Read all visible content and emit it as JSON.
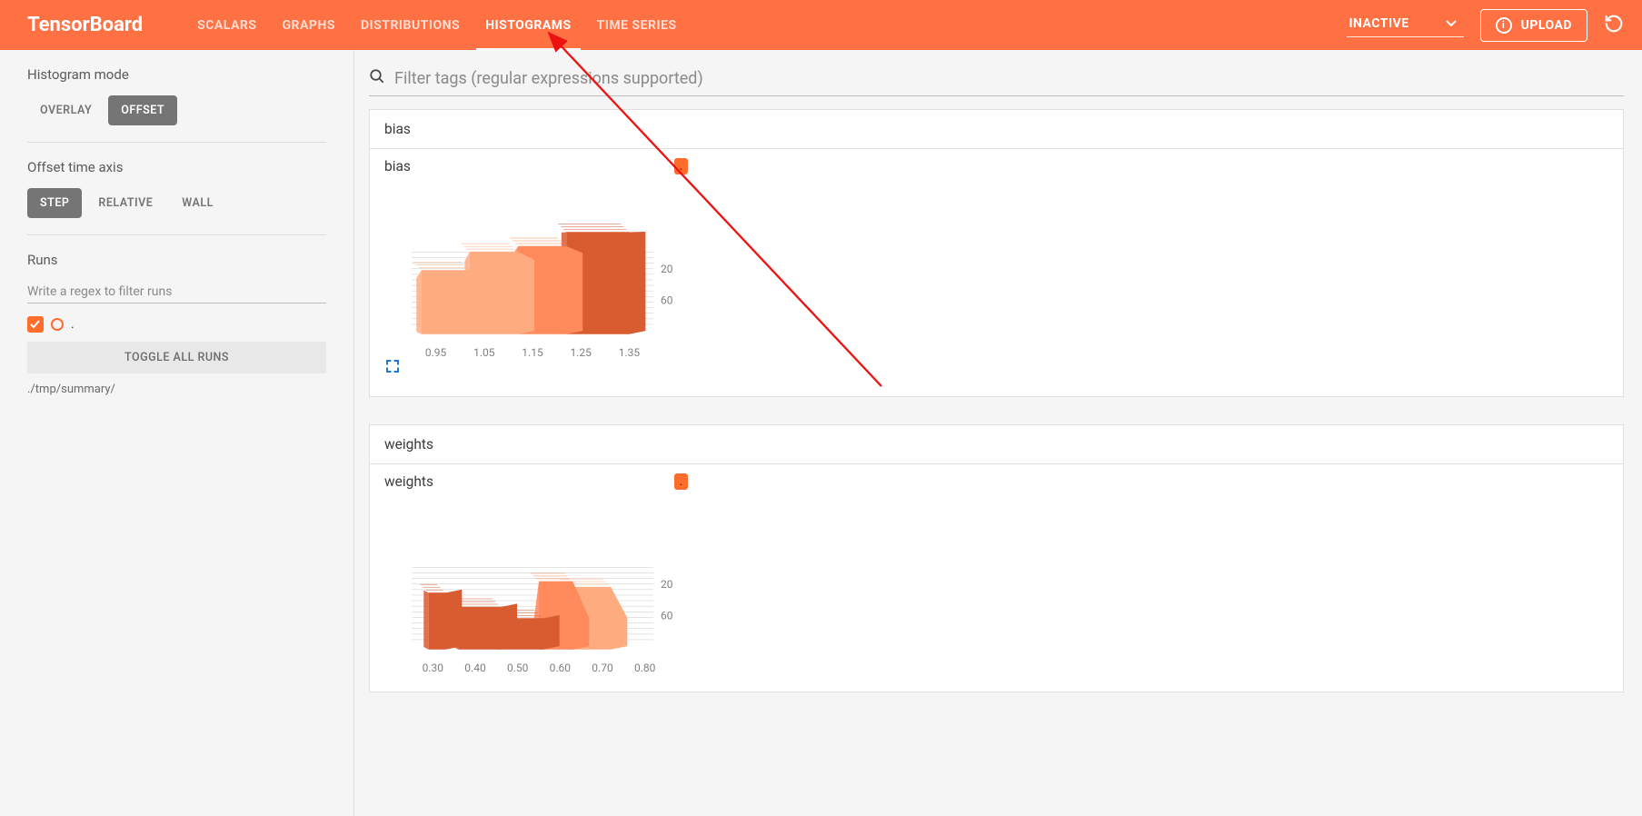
{
  "header": {
    "logo": "TensorBoard",
    "tabs": [
      "SCALARS",
      "GRAPHS",
      "DISTRIBUTIONS",
      "HISTOGRAMS",
      "TIME SERIES"
    ],
    "active_tab": 3,
    "inactive_label": "INACTIVE",
    "upload_label": "UPLOAD"
  },
  "sidebar": {
    "hist_mode_title": "Histogram mode",
    "hist_modes": [
      "OVERLAY",
      "OFFSET"
    ],
    "hist_mode_sel": 1,
    "offset_axis_title": "Offset time axis",
    "offset_modes": [
      "STEP",
      "RELATIVE",
      "WALL"
    ],
    "offset_mode_sel": 0,
    "runs_title": "Runs",
    "runs_placeholder": "Write a regex to filter runs",
    "run_dot": ".",
    "toggle_runs": "TOGGLE ALL RUNS",
    "path": "./tmp/summary/"
  },
  "main": {
    "filter_placeholder": "Filter tags (regular expressions supported)"
  },
  "colors": {
    "accent": "#ff7043",
    "run": "#ff6d2d",
    "series_front": "#ffab80",
    "series_mid": "#ff8a5c",
    "series_back": "#d95b30",
    "grid": "#d5d5d5",
    "tick": "#808080"
  },
  "chart_data": [
    {
      "name": "bias",
      "card_title": "bias",
      "type": "histogram-offset",
      "x_ticks": [
        "0.95",
        "1.05",
        "1.15",
        "1.25",
        "1.35"
      ],
      "y_ticks": [
        "20",
        "60"
      ],
      "xlim": [
        0.9,
        1.4
      ],
      "layers": [
        {
          "x_left": 0.92,
          "x_right": 1.02,
          "top_left": 1.05,
          "top_right": 1.05,
          "h_front": 0.45,
          "h_back": 0.38,
          "color": "series_front"
        },
        {
          "x_left": 1.02,
          "x_right": 1.12,
          "top_left": 0.95,
          "top_right": 1.0,
          "h_front": 0.58,
          "h_back": 0.5,
          "color": "series_front"
        },
        {
          "x_left": 1.12,
          "x_right": 1.22,
          "top_left": 0.93,
          "top_right": 0.97,
          "h_front": 0.62,
          "h_back": 0.55,
          "color": "series_mid"
        },
        {
          "x_left": 1.22,
          "x_right": 1.35,
          "top_left": 0.88,
          "top_right": 0.92,
          "h_front": 0.72,
          "h_back": 0.7,
          "color": "series_back"
        }
      ]
    },
    {
      "name": "weights",
      "card_title": "weights",
      "type": "histogram-offset",
      "x_ticks": [
        "0.30",
        "0.40",
        "0.50",
        "0.60",
        "0.70",
        "0.80"
      ],
      "y_ticks": [
        "20",
        "60"
      ],
      "xlim": [
        0.25,
        0.82
      ],
      "layers": [
        {
          "x_left": 0.29,
          "x_right": 0.33,
          "top_left": 0.96,
          "top_right": 0.96,
          "h_front": 0.4,
          "h_back": 0.4,
          "color": "series_back"
        },
        {
          "x_left": 0.36,
          "x_right": 0.46,
          "top_left": 0.75,
          "top_right": 0.8,
          "h_front": 0.3,
          "h_back": 0.3,
          "color": "series_back"
        },
        {
          "x_left": 0.45,
          "x_right": 0.56,
          "top_left": 0.66,
          "top_right": 0.7,
          "h_front": 0.22,
          "h_back": 0.22,
          "color": "series_back"
        },
        {
          "x_left": 0.55,
          "x_right": 0.63,
          "top_left": 0.56,
          "top_right": 0.6,
          "h_front": 0.48,
          "h_back": 0.2,
          "color": "series_mid"
        },
        {
          "x_left": 0.62,
          "x_right": 0.72,
          "top_left": 0.45,
          "top_right": 0.5,
          "h_front": 0.44,
          "h_back": 0.2,
          "color": "series_front"
        }
      ]
    }
  ]
}
